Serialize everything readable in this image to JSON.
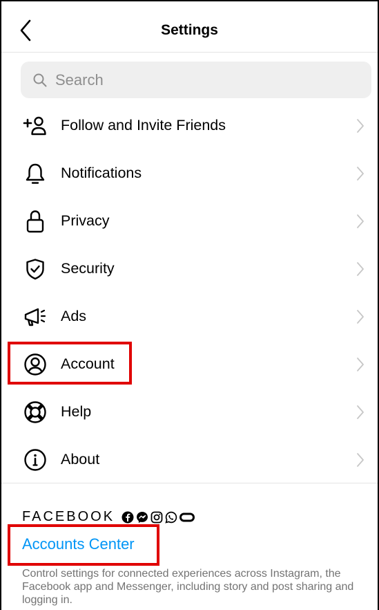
{
  "header": {
    "title": "Settings",
    "back_icon": "chevron-left-icon"
  },
  "search": {
    "placeholder": "Search",
    "value": ""
  },
  "menu": {
    "items": [
      {
        "label": "Follow and Invite Friends",
        "icon": "add-person-icon"
      },
      {
        "label": "Notifications",
        "icon": "bell-icon"
      },
      {
        "label": "Privacy",
        "icon": "lock-icon"
      },
      {
        "label": "Security",
        "icon": "shield-check-icon"
      },
      {
        "label": "Ads",
        "icon": "megaphone-icon"
      },
      {
        "label": "Account",
        "icon": "person-circle-icon"
      },
      {
        "label": "Help",
        "icon": "lifebuoy-icon"
      },
      {
        "label": "About",
        "icon": "info-circle-icon"
      }
    ]
  },
  "facebook": {
    "label": "FACEBOOK",
    "icons": [
      "facebook-icon",
      "messenger-icon",
      "instagram-icon",
      "whatsapp-icon",
      "portal-icon"
    ],
    "accounts_center_label": "Accounts Center",
    "description": "Control settings for connected experiences across Instagram, the Facebook app and Messenger, including story and post sharing and logging in."
  },
  "colors": {
    "link": "#0095f6",
    "highlight": "#e00000",
    "secondary_text": "#737373",
    "search_bg": "#efefef"
  }
}
